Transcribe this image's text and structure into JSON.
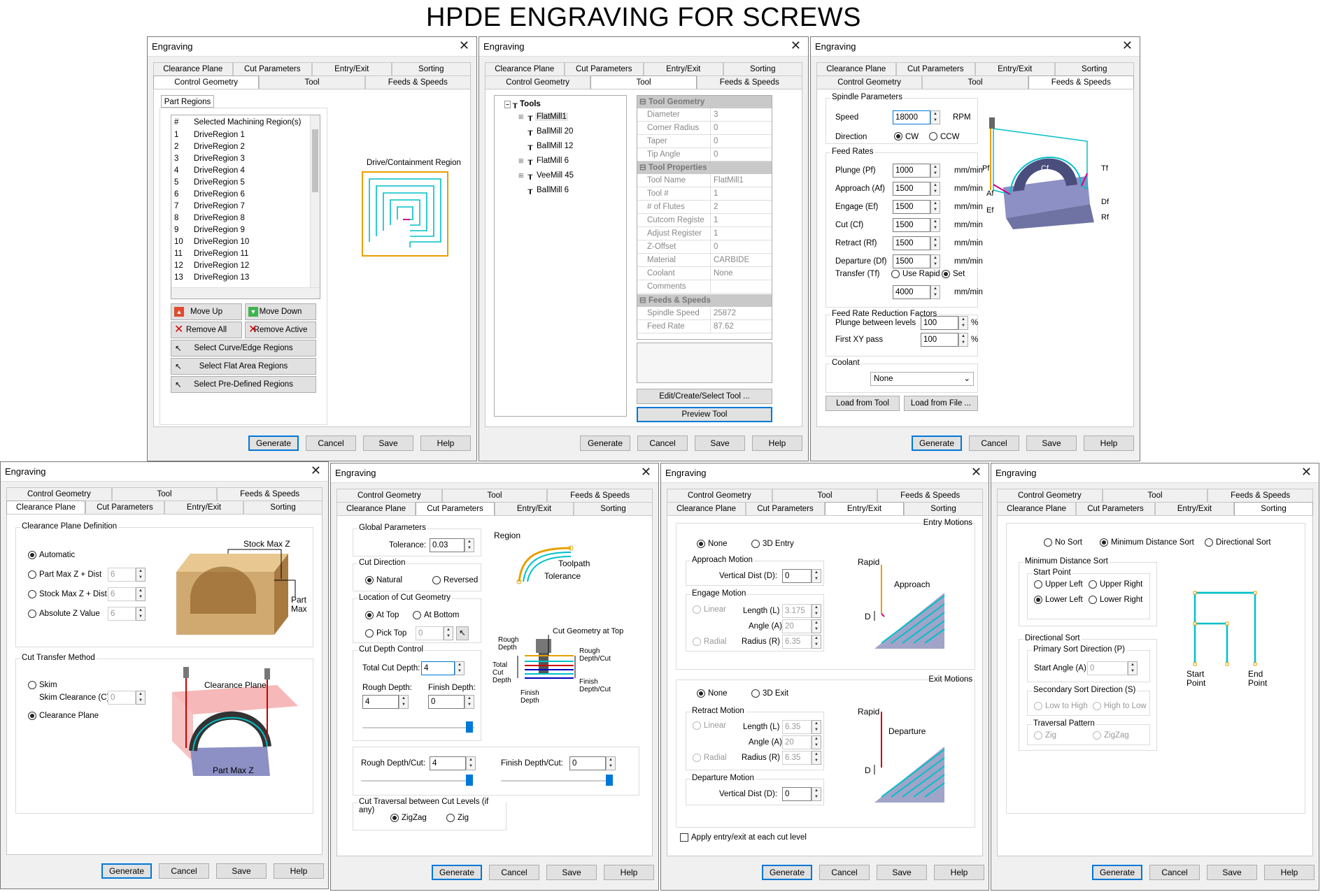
{
  "title": "HPDE ENGRAVING FOR SCREWS",
  "window_title": "Engraving",
  "close": "✕",
  "tabs_row_a": [
    "Clearance Plane",
    "Cut Parameters",
    "Entry/Exit",
    "Sorting"
  ],
  "tabs_row_b": [
    "Control Geometry",
    "Tool",
    "Feeds & Speeds"
  ],
  "buttons": {
    "generate": "Generate",
    "cancel": "Cancel",
    "save": "Save",
    "help": "Help"
  },
  "cg": {
    "group": "Part Regions",
    "col_num": "#",
    "col_name": "Selected Machining Region(s)",
    "regions": [
      {
        "n": "1",
        "name": "DriveRegion 1"
      },
      {
        "n": "2",
        "name": "DriveRegion 2"
      },
      {
        "n": "3",
        "name": "DriveRegion 3"
      },
      {
        "n": "4",
        "name": "DriveRegion 4"
      },
      {
        "n": "5",
        "name": "DriveRegion 5"
      },
      {
        "n": "6",
        "name": "DriveRegion 6"
      },
      {
        "n": "7",
        "name": "DriveRegion 7"
      },
      {
        "n": "8",
        "name": "DriveRegion 8"
      },
      {
        "n": "9",
        "name": "DriveRegion 9"
      },
      {
        "n": "10",
        "name": "DriveRegion 10"
      },
      {
        "n": "11",
        "name": "DriveRegion 11"
      },
      {
        "n": "12",
        "name": "DriveRegion 12"
      },
      {
        "n": "13",
        "name": "DriveRegion 13"
      }
    ],
    "move_up": "Move Up",
    "move_down": "Move Down",
    "remove_all": "Remove All",
    "remove_active": "Remove Active",
    "sel_curve": "Select Curve/Edge Regions",
    "sel_flat": "Select Flat Area Regions",
    "sel_pre": "Select Pre-Defined Regions",
    "diagram_label": "Drive/Containment Region"
  },
  "tool": {
    "root": "Tools",
    "items": [
      "FlatMill1",
      "BallMill 20",
      "BallMill 12",
      "FlatMill 6",
      "VeeMill 45",
      "BallMill 6"
    ],
    "sec_geom": "Tool Geometry",
    "geom": [
      {
        "k": "Diameter",
        "v": "3"
      },
      {
        "k": "Corner Radius",
        "v": "0"
      },
      {
        "k": "Taper",
        "v": "0"
      },
      {
        "k": "Tip Angle",
        "v": "0"
      }
    ],
    "sec_props": "Tool Properties",
    "props": [
      {
        "k": "Tool Name",
        "v": "FlatMill1"
      },
      {
        "k": "Tool #",
        "v": "1"
      },
      {
        "k": "# of Flutes",
        "v": "2"
      },
      {
        "k": "Cutcom Registe",
        "v": "1"
      },
      {
        "k": "Adjust Register",
        "v": "1"
      },
      {
        "k": "Z-Offset",
        "v": "0"
      },
      {
        "k": "Material",
        "v": "CARBIDE"
      },
      {
        "k": "Coolant",
        "v": "None"
      },
      {
        "k": "Comments",
        "v": ""
      }
    ],
    "sec_fs": "Feeds & Speeds",
    "fs": [
      {
        "k": "Spindle Speed",
        "v": "25872"
      },
      {
        "k": "Feed Rate",
        "v": "87.62"
      }
    ],
    "edit": "Edit/Create/Select Tool ...",
    "preview": "Preview Tool"
  },
  "fs": {
    "spindle": "Spindle Parameters",
    "speed": "Speed",
    "speed_val": "18000",
    "rpm": "RPM",
    "direction": "Direction",
    "cw": "CW",
    "ccw": "CCW",
    "feed_rates": "Feed Rates",
    "rates": [
      {
        "k": "Plunge (Pf)",
        "v": "1000"
      },
      {
        "k": "Approach (Af)",
        "v": "1500"
      },
      {
        "k": "Engage (Ef)",
        "v": "1500"
      },
      {
        "k": "Cut (Cf)",
        "v": "1500"
      },
      {
        "k": "Retract (Rf)",
        "v": "1500"
      },
      {
        "k": "Departure  (Df)",
        "v": "1500"
      }
    ],
    "unit": "mm/min",
    "transfer": "Transfer (Tf)",
    "use_rapid": "Use Rapid",
    "set": "Set",
    "transfer_val": "4000",
    "reduction": "Feed Rate Reduction Factors",
    "plunge_between": "Plunge between levels",
    "plunge_val": "100",
    "first_xy": "First XY pass",
    "first_val": "100",
    "pct": "%",
    "coolant": "Coolant",
    "coolant_val": "None",
    "load_tool": "Load from Tool",
    "load_file": "Load from File ...",
    "d_pf": "Pf",
    "d_af": "Af",
    "d_ef": "Ef",
    "d_cf": "Cf",
    "d_tf": "Tf",
    "d_df": "Df",
    "d_rf": "Rf"
  },
  "cp": {
    "def": "Clearance Plane Definition",
    "automatic": "Automatic",
    "pmz": "Part Max Z + Dist",
    "smz": "Stock Max Z + Dist",
    "abs": "Absolute Z Value",
    "val": "6",
    "stock_max": "Stock Max Z",
    "part_max": "Part\nMax Z",
    "ctm": "Cut Transfer Method",
    "skim": "Skim",
    "skim_c": "Skim Clearance (C)",
    "skim_val": "0",
    "clear": "Clearance Plane",
    "d_clear": "Clearance Plane",
    "d_partmax": "Part Max Z"
  },
  "cut": {
    "global": "Global Parameters",
    "tol": "Tolerance:",
    "tol_val": "0.03",
    "dir": "Cut Direction",
    "natural": "Natural",
    "reversed": "Reversed",
    "loc": "Location of Cut Geometry",
    "at_top": "At Top",
    "at_bottom": "At Bottom",
    "pick_top": "Pick Top",
    "pick_val": "0",
    "depth": "Cut Depth Control",
    "total": "Total Cut Depth:",
    "total_val": "4",
    "rough": "Rough Depth:",
    "rough_val": "4",
    "finish": "Finish Depth:",
    "finish_val": "0",
    "rough_cut": "Rough Depth/Cut:",
    "rough_cut_val": "4",
    "finish_cut": "Finish Depth/Cut:",
    "finish_cut_val": "0",
    "trav": "Cut Traversal between Cut Levels (if any)",
    "zigzag": "ZigZag",
    "zig": "Zig",
    "d_region": "Region",
    "d_toolpath": "Toolpath",
    "d_tol": "Tolerance",
    "d_cgt": "Cut Geometry at Top",
    "d_rd": "Rough\nDepth",
    "d_tcd": "Total\nCut\nDepth",
    "d_fd": "Finish\nDepth",
    "d_rdc": "Rough\nDepth/Cut",
    "d_fdc": "Finish\nDepth/Cut"
  },
  "ee": {
    "entry": "Entry Motions",
    "none": "None",
    "entry3d": "3D Entry",
    "approach": "Approach Motion",
    "vdist": "Vertical Dist (D):",
    "vdist_val": "0",
    "engage": "Engage Motion",
    "linear": "Linear",
    "length": "Length (L)",
    "len_val": "3.175",
    "angle": "Angle (A)",
    "ang_val": "20",
    "radial": "Radial",
    "radius": "Radius (R)",
    "rad_val": "6.35",
    "exit": "Exit Motions",
    "exit3d": "3D Exit",
    "retract": "Retract Motion",
    "len2": "6.35",
    "ang2": "20",
    "rad2": "6.35",
    "departure": "Departure Motion",
    "dvdist_val": "0",
    "apply": "Apply entry/exit at each cut level",
    "d_rapid": "Rapid",
    "d_approach": "Approach",
    "d_departure": "Departure",
    "d_d": "D"
  },
  "sort": {
    "no": "No Sort",
    "min": "Minimum Distance Sort",
    "dir": "Directional Sort",
    "mds": "Minimum Distance Sort",
    "sp": "Start Point",
    "ul": "Upper Left",
    "ur": "Upper Right",
    "ll": "Lower Left",
    "lr": "Lower Right",
    "ds": "Directional Sort",
    "psd": "Primary Sort Direction (P)",
    "sa": "Start Angle (A)",
    "sa_val": "0",
    "ssd": "Secondary Sort Direction (S)",
    "lth": "Low to High",
    "htl": "High to Low",
    "tp": "Traversal Pattern",
    "zig": "Zig",
    "zigzag": "ZigZag",
    "d_start": "Start\nPoint",
    "d_end": "End\nPoint"
  },
  "colors": {
    "accent": "#0078d7",
    "path": "#00c0c8",
    "orange": "#e8a000"
  }
}
